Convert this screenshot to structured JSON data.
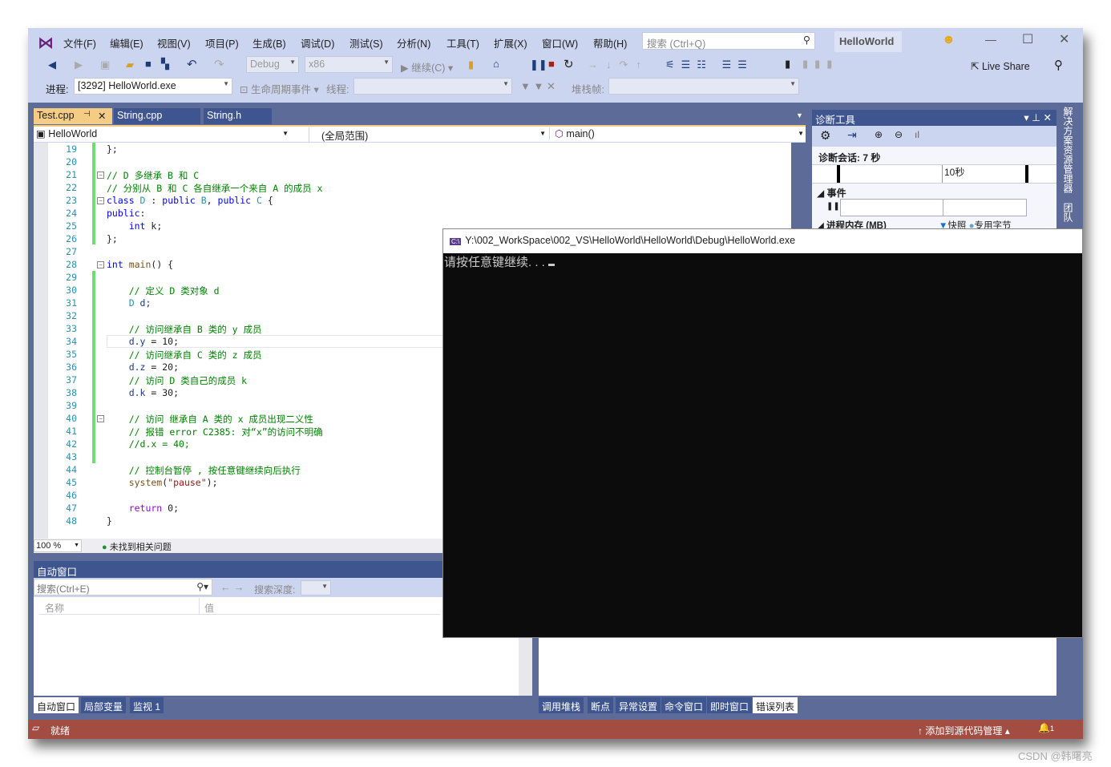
{
  "menu": [
    "文件(F)",
    "编辑(E)",
    "视图(V)",
    "项目(P)",
    "生成(B)",
    "调试(D)",
    "测试(S)",
    "分析(N)",
    "工具(T)",
    "扩展(X)",
    "窗口(W)",
    "帮助(H)"
  ],
  "search": {
    "placeholder": "搜索 (Ctrl+Q)"
  },
  "solution_name": "HelloWorld",
  "toolbar": {
    "config": "Debug",
    "platform": "x86",
    "continue": "继续(C)",
    "live_share": "Live Share",
    "process_label": "进程:",
    "process": "[3292] HelloWorld.exe",
    "lifecycle": "生命周期事件",
    "thread_label": "线程:",
    "stack_label": "堆栈帧:"
  },
  "tabs": [
    {
      "label": "Test.cpp",
      "active": true
    },
    {
      "label": "String.cpp"
    },
    {
      "label": "String.h"
    }
  ],
  "nav": {
    "project": "HelloWorld",
    "scope": "(全局范围)",
    "member": "main()"
  },
  "code": [
    {
      "n": "19",
      "segs": [
        [
          "};",
          "pl"
        ]
      ]
    },
    {
      "n": "20",
      "segs": []
    },
    {
      "n": "21",
      "segs": [
        [
          "// D 多继承 B 和 C",
          "cm"
        ]
      ]
    },
    {
      "n": "22",
      "segs": [
        [
          "// 分别从 B 和 C 各自继承一个来自 A 的成员 x",
          "cm"
        ]
      ]
    },
    {
      "n": "23",
      "segs": [
        [
          "class ",
          "kw"
        ],
        [
          "D",
          "ty"
        ],
        [
          " : ",
          "pl"
        ],
        [
          "public ",
          "kw"
        ],
        [
          "B",
          "ty"
        ],
        [
          ", ",
          "pl"
        ],
        [
          "public ",
          "kw"
        ],
        [
          "C",
          "ty"
        ],
        [
          " {",
          "pl"
        ]
      ]
    },
    {
      "n": "24",
      "segs": [
        [
          "public",
          "kw"
        ],
        [
          ":",
          "pl"
        ]
      ]
    },
    {
      "n": "25",
      "segs": [
        [
          "    int ",
          "kw"
        ],
        [
          "k;",
          "pl"
        ]
      ]
    },
    {
      "n": "26",
      "segs": [
        [
          "};",
          "pl"
        ]
      ]
    },
    {
      "n": "27",
      "segs": []
    },
    {
      "n": "28",
      "segs": [
        [
          "int ",
          "kw"
        ],
        [
          "main",
          "fn"
        ],
        [
          "() {",
          "pl"
        ]
      ]
    },
    {
      "n": "29",
      "segs": []
    },
    {
      "n": "30",
      "segs": [
        [
          "    // 定义 D 类对象 d",
          "cm"
        ]
      ]
    },
    {
      "n": "31",
      "segs": [
        [
          "    D ",
          "ty"
        ],
        [
          "d;",
          "vr"
        ]
      ]
    },
    {
      "n": "32",
      "segs": []
    },
    {
      "n": "33",
      "segs": [
        [
          "    // 访问继承自 B 类的 y 成员",
          "cm"
        ]
      ]
    },
    {
      "n": "34",
      "segs": [
        [
          "    d.y",
          "vr"
        ],
        [
          " = 10;",
          "pl"
        ]
      ]
    },
    {
      "n": "35",
      "segs": [
        [
          "    // 访问继承自 C 类的 z 成员",
          "cm"
        ]
      ]
    },
    {
      "n": "36",
      "segs": [
        [
          "    d.z",
          "vr"
        ],
        [
          " = 20;",
          "pl"
        ]
      ]
    },
    {
      "n": "37",
      "segs": [
        [
          "    // 访问 D 类自己的成员 k",
          "cm"
        ]
      ]
    },
    {
      "n": "38",
      "segs": [
        [
          "    d.k",
          "vr"
        ],
        [
          " = 30;",
          "pl"
        ]
      ]
    },
    {
      "n": "39",
      "segs": []
    },
    {
      "n": "40",
      "segs": [
        [
          "    // 访问 继承自 A 类的 x 成员出现二义性",
          "cm"
        ]
      ]
    },
    {
      "n": "41",
      "segs": [
        [
          "    // 报错 error C2385: 对“x”的访问不明确",
          "cm"
        ]
      ]
    },
    {
      "n": "42",
      "segs": [
        [
          "    //d.x = 40;",
          "cm"
        ]
      ]
    },
    {
      "n": "43",
      "segs": []
    },
    {
      "n": "44",
      "segs": [
        [
          "    // 控制台暂停 , 按任意键继续向后执行",
          "cm"
        ]
      ]
    },
    {
      "n": "45",
      "segs": [
        [
          "    system",
          "fn"
        ],
        [
          "(",
          "pl"
        ],
        [
          "\"pause\"",
          "st"
        ],
        [
          ");",
          "pl"
        ]
      ]
    },
    {
      "n": "46",
      "segs": []
    },
    {
      "n": "47",
      "segs": [
        [
          "    return ",
          "rt"
        ],
        [
          "0;",
          "pl"
        ]
      ]
    },
    {
      "n": "48",
      "segs": [
        [
          "}",
          "pl"
        ]
      ]
    }
  ],
  "editor_status": {
    "zoom": "100 %",
    "issues": "未找到相关问题"
  },
  "auto_window": {
    "title": "自动窗口",
    "search_placeholder": "搜索(Ctrl+E)",
    "depth_label": "搜索深度:",
    "col_name": "名称",
    "col_value": "值"
  },
  "diag": {
    "title": "诊断工具",
    "session": "诊断会话: 7 秒",
    "tick": "10秒",
    "events": "事件",
    "memory": "进程内存 (MB)",
    "snapshot": "快照",
    "private_bytes": "专用字节"
  },
  "side_tabs": [
    "解决方案资源管理器",
    "团队资"
  ],
  "console": {
    "title": "Y:\\002_WorkSpace\\002_VS\\HelloWorld\\HelloWorld\\Debug\\HelloWorld.exe",
    "output": "请按任意键继续. . . "
  },
  "bottom_left_tabs": [
    "自动窗口",
    "局部变量",
    "监视 1"
  ],
  "bottom_right_tabs": [
    "调用堆栈",
    "断点",
    "异常设置",
    "命令窗口",
    "即时窗口",
    "错误列表"
  ],
  "status": {
    "text": "就绪",
    "source_control": "添加到源代码管理",
    "notifications": "1"
  },
  "watermark": "CSDN @韩曙亮",
  "colors": {
    "accent": "#68217a",
    "status_bar": "#a34c42",
    "chrome": "#ccd5f0",
    "panel": "#5d6b99"
  }
}
